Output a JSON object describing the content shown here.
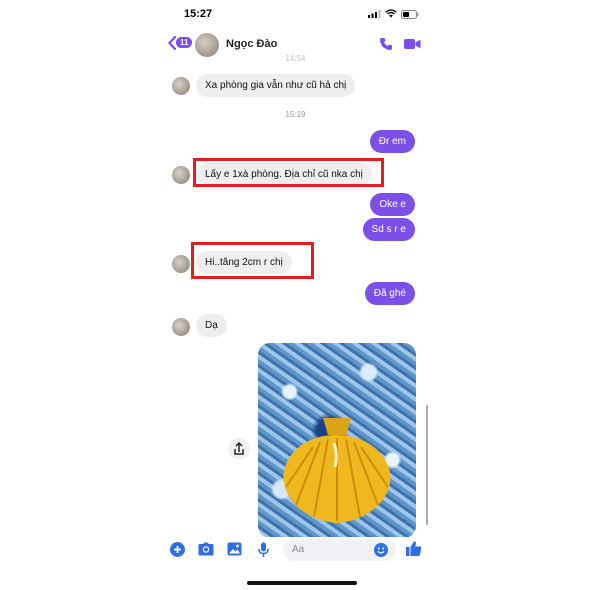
{
  "status": {
    "time": "15:27"
  },
  "header": {
    "back_badge": "11",
    "contact_name": "Ngọc Đào"
  },
  "messages": {
    "ts1": "14:54",
    "m1": "Xa phòng gia vẫn như cũ hả chị",
    "ts2": "15:19",
    "m2": "Đr em",
    "m3": "Lấy e 1xà phòng. Địa chỉ cũ nka chị",
    "m4": "Oke e",
    "m5": "Sd s r e",
    "m6": "Hi..tăng 2cm r chị",
    "m7": "Đã ghé",
    "m8": "Dạ"
  },
  "composer": {
    "placeholder": "Aa"
  },
  "colors": {
    "accent": "#7c4fe6",
    "highlight": "#e51c23"
  },
  "icons": [
    "back-chevron-icon",
    "call-icon",
    "video-icon",
    "share-icon",
    "plus-icon",
    "camera-icon",
    "gallery-icon",
    "mic-icon",
    "emoji-icon",
    "like-icon"
  ]
}
